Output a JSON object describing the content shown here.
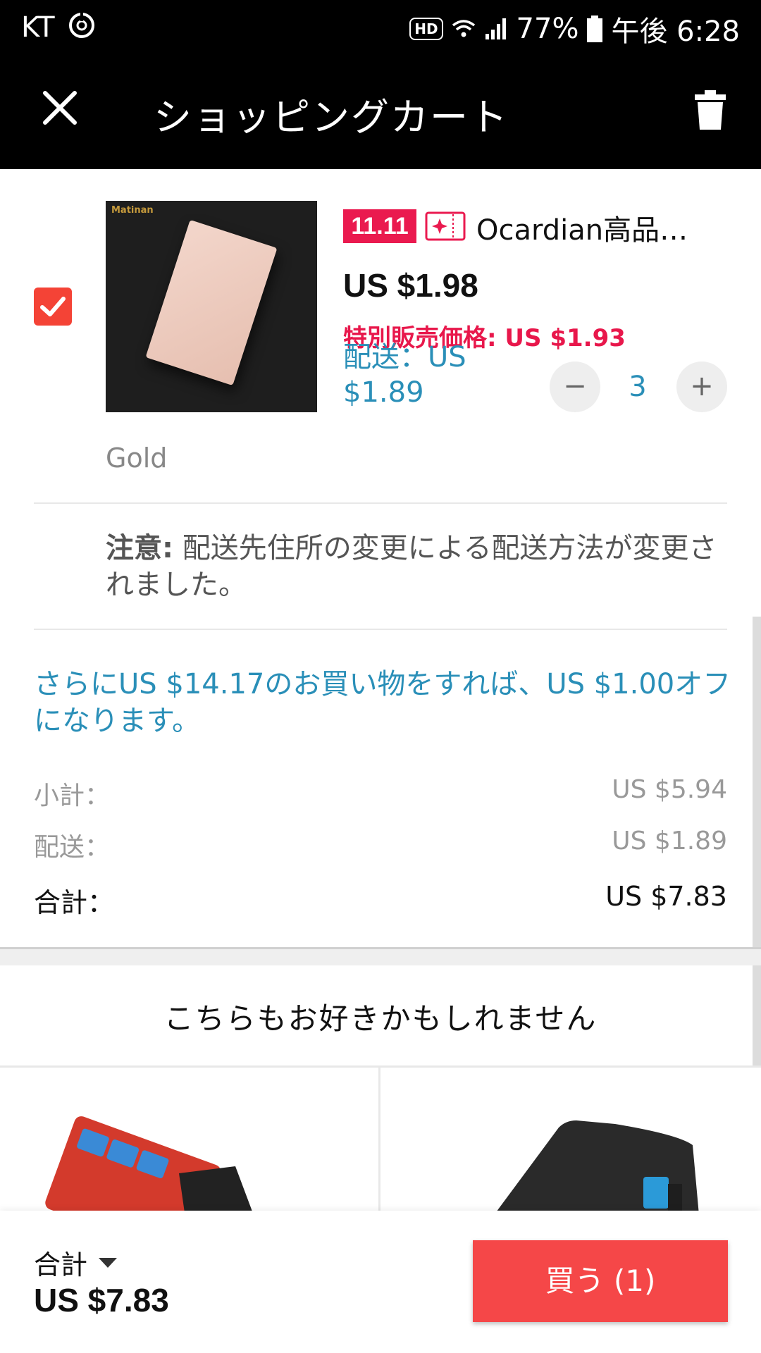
{
  "status_bar": {
    "carrier": "KT",
    "hd": "HD",
    "battery": "77%",
    "time": "午後 6:28"
  },
  "header": {
    "title": "ショッピングカート",
    "close_icon": "close-icon",
    "delete_icon": "trash-icon"
  },
  "cart_item": {
    "checked": true,
    "image_logo": "Matinan",
    "event_badge": "11.11",
    "title": "Ocardian高品質…",
    "price": "US $1.98",
    "special_price": "特別販売価格: US $1.93",
    "shipping": "配送：US $1.89",
    "quantity": "3",
    "minus_label": "−",
    "plus_label": "+",
    "variant": "Gold"
  },
  "notice": {
    "label": "注意:",
    "text": " 配送先住所の変更による配送方法が変更されました。"
  },
  "promo": {
    "text": "さらにUS $14.17のお買い物をすれば、US $1.00オフになります。"
  },
  "summary": {
    "subtotal_label": "小計：",
    "subtotal_value": "US $5.94",
    "shipping_label": "配送：",
    "shipping_value": "US $1.89",
    "total_label": "合計：",
    "total_value": "US $7.83"
  },
  "recommendations": {
    "title": "こちらもお好きかもしれません"
  },
  "bottom_bar": {
    "total_label": "合計",
    "total_value": "US $7.83",
    "buy_label": "買う (1)"
  },
  "colors": {
    "accent_red": "#f54748",
    "link_blue": "#2a8fb8",
    "sale_pink": "#e8174b"
  }
}
